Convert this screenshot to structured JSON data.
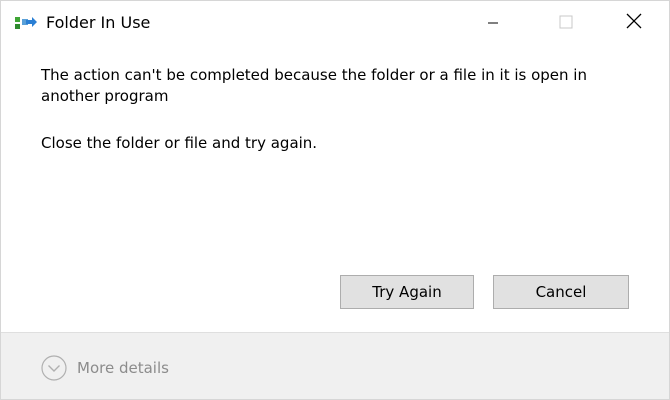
{
  "window": {
    "title": "Folder In Use",
    "title_icon": "folder-move-icon",
    "controls": {
      "minimize_icon": "minimize-icon",
      "maximize_icon": "maximize-icon",
      "close_icon": "close-icon"
    }
  },
  "message": {
    "main": "The action can't be completed because the folder or a file in it is open in another program",
    "instruction": "Close the folder or file and try again."
  },
  "buttons": {
    "try_again_label": "Try Again",
    "cancel_label": "Cancel"
  },
  "footer": {
    "more_details_label": "More details",
    "more_details_icon": "chevron-down-circle-icon"
  },
  "colors": {
    "button_bg": "#e1e1e1",
    "button_border": "#adadad",
    "footer_bg": "#f0f0f0",
    "muted_text": "#8c8c8c"
  }
}
